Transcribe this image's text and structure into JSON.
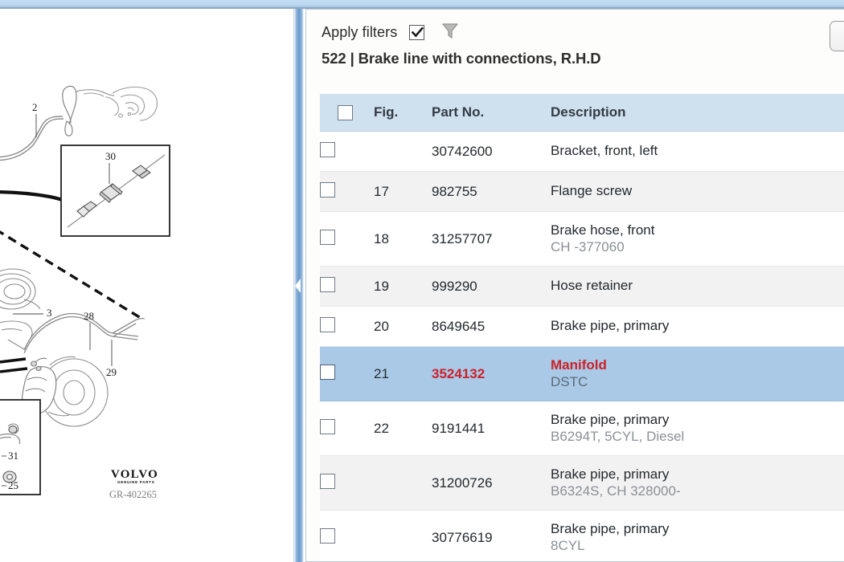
{
  "window": {
    "splitter_handle_icon": "chevron-left-icon"
  },
  "left_panel": {
    "name": "parts-diagram",
    "volvo_logo_text": "VOLVO",
    "volvo_logo_sub": "GENUINE PARTS",
    "drawing_code": "GR-402265",
    "callouts": [
      "2",
      "30",
      "3",
      "28",
      "29",
      "31",
      "25"
    ]
  },
  "filter_bar": {
    "apply_filters_label": "Apply filters",
    "apply_filters_checked": true,
    "checkbox_icon": "checkmark-icon",
    "funnel_icon": "filter-funnel-icon",
    "corner_button_icon": "blank-button"
  },
  "header": {
    "section_number": "522",
    "separator": "|",
    "section_title": "Brake line with connections, R.H.D"
  },
  "table": {
    "columns": {
      "select": "",
      "fig": "Fig.",
      "part_no": "Part No.",
      "description": "Description"
    },
    "rows": [
      {
        "fig": "",
        "part_no": "30742600",
        "description": "Bracket, front, left",
        "sub": "",
        "selected": false,
        "stripe": "odd"
      },
      {
        "fig": "17",
        "part_no": "982755",
        "description": "Flange screw",
        "sub": "",
        "selected": false,
        "stripe": "even"
      },
      {
        "fig": "18",
        "part_no": "31257707",
        "description": "Brake hose, front",
        "sub": "CH -377060",
        "selected": false,
        "stripe": "odd"
      },
      {
        "fig": "19",
        "part_no": "999290",
        "description": "Hose retainer",
        "sub": "",
        "selected": false,
        "stripe": "even"
      },
      {
        "fig": "20",
        "part_no": "8649645",
        "description": "Brake pipe, primary",
        "sub": "",
        "selected": false,
        "stripe": "odd"
      },
      {
        "fig": "21",
        "part_no": "3524132",
        "description": "Manifold",
        "sub": "DSTC",
        "selected": true,
        "stripe": "selected"
      },
      {
        "fig": "22",
        "part_no": "9191441",
        "description": "Brake pipe, primary",
        "sub": "B6294T, 5CYL, Diesel",
        "selected": false,
        "stripe": "odd"
      },
      {
        "fig": "",
        "part_no": "31200726",
        "description": "Brake pipe, primary",
        "sub": "B6324S, CH 328000-",
        "selected": false,
        "stripe": "even"
      },
      {
        "fig": "",
        "part_no": "30776619",
        "description": "Brake pipe, primary",
        "sub": "8CYL",
        "selected": false,
        "stripe": "odd"
      }
    ]
  },
  "colors": {
    "selected_row": "#a9c9e7",
    "header_row": "#cfe0ef",
    "highlight_text": "#cc2229",
    "sub_text": "#8b9096",
    "splitter": "#6b9bcb"
  }
}
